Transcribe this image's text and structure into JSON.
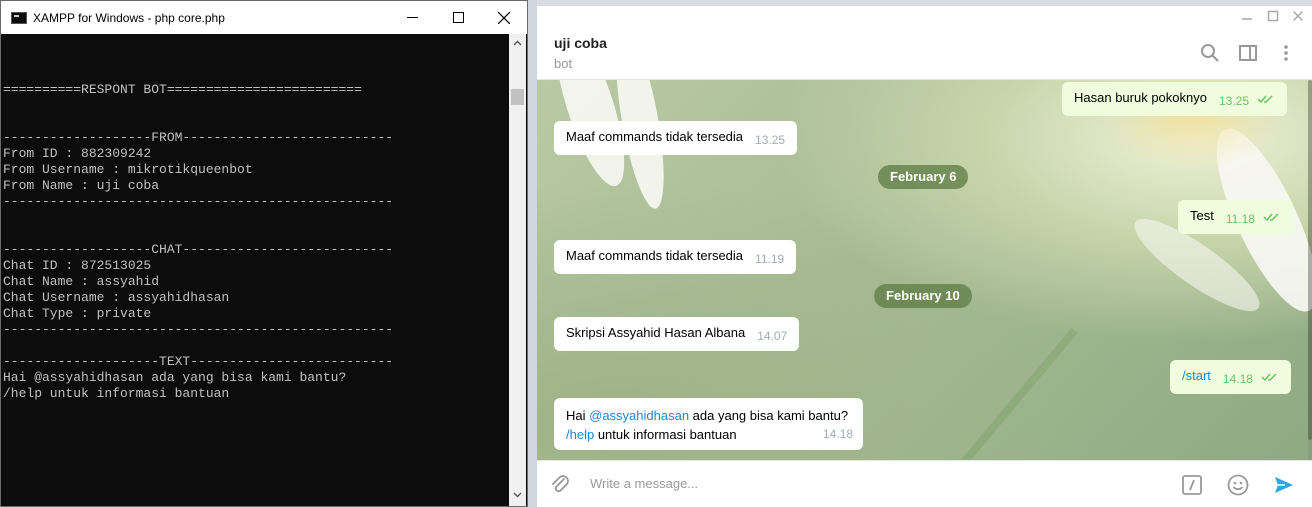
{
  "console": {
    "title": "XAMPP for Windows - php  core.php",
    "lines": [
      "==========RESPONT BOT=========================",
      "-------------------FROM---------------------------",
      "From ID : 882309242",
      "From Username : mikrotikqueenbot",
      "From Name : uji coba",
      "--------------------------------------------------",
      "-------------------CHAT---------------------------",
      "Chat ID : 872513025",
      "Chat Name : assyahid",
      "Chat Username : assyahidhasan",
      "Chat Type : private",
      "--------------------------------------------------",
      "--------------------TEXT--------------------------",
      "Hai @assyahidhasan ada yang bisa kami bantu?",
      "/help untuk informasi bantuan"
    ]
  },
  "telegram": {
    "chat_name": "uji coba",
    "chat_status": "bot",
    "input_placeholder": "Write a message...",
    "messages": [
      {
        "text": "Hasan buruk pokoknyo",
        "time": "13.25",
        "dir": "out"
      },
      {
        "text": "Maaf commands tidak tersedia",
        "time": "13.25",
        "dir": "in"
      },
      {
        "date": "February 6"
      },
      {
        "text": "Test",
        "time": "11.18",
        "dir": "out"
      },
      {
        "text": "Maaf commands tidak tersedia",
        "time": "11.19",
        "dir": "in"
      },
      {
        "date": "February 10"
      },
      {
        "text": "Skripsi Assyahid Hasan Albana",
        "time": "14.07",
        "dir": "in"
      },
      {
        "text": "/start",
        "time": "14.18",
        "dir": "out"
      },
      {
        "line1_pre": "Hai ",
        "mention": "@assyahidhasan",
        "line1_post": " ada yang bisa kami bantu?",
        "command": "/help",
        "line2_post": " untuk informasi bantuan",
        "time": "14.18",
        "dir": "in"
      }
    ],
    "colors": {
      "accent": "#168acd",
      "out_bubble": "#effdde",
      "in_bubble": "#ffffff",
      "read_check": "#6cc264"
    }
  },
  "icons": [
    "console-app-icon",
    "minimize-icon",
    "maximize-icon",
    "close-icon",
    "search-icon",
    "sidebar-toggle-icon",
    "more-vertical-icon",
    "attach-icon",
    "bot-command-icon",
    "emoji-icon",
    "send-icon"
  ]
}
